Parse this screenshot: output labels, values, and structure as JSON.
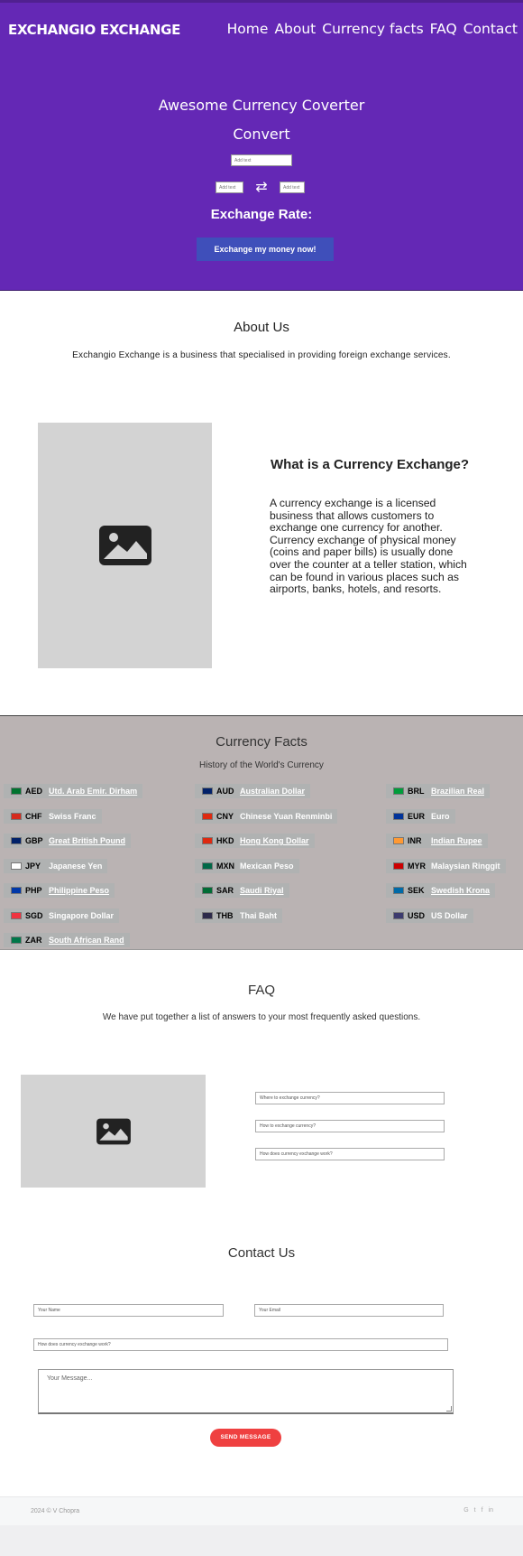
{
  "header": {
    "brand": "EXCHANGIO EXCHANGE",
    "nav": [
      "Home",
      "About",
      "Currency facts",
      "FAQ",
      "Contact"
    ]
  },
  "hero": {
    "title": "Awesome Currency Coverter",
    "convert_label": "Convert",
    "amount_placeholder": "Add text",
    "from_placeholder": "Add text",
    "to_placeholder": "Add text",
    "rate_label": "Exchange Rate:",
    "button": "Exchange my money now!"
  },
  "about": {
    "title": "About Us",
    "text": "Exchangio Exchange is a business that specialised in providing foreign exchange services.",
    "subtitle": "What is a Currency Exchange?",
    "body": "A currency exchange is a licensed business that allows customers to exchange one currency for another. Currency exchange of physical money (coins and paper bills) is usually done over the counter at a teller station, which can be found in various places such as airports, banks, hotels, and resorts."
  },
  "facts": {
    "title": "Currency Facts",
    "subtitle": "History of the World's Currency",
    "currencies": [
      {
        "code": "AED",
        "name": "Utd. Arab Emir. Dirham",
        "link": true,
        "flag": "#00732f"
      },
      {
        "code": "AUD",
        "name": "Australian Dollar",
        "link": true,
        "flag": "#012169"
      },
      {
        "code": "BRL",
        "name": "Brazilian Real",
        "link": true,
        "flag": "#009c3b"
      },
      {
        "code": "CHF",
        "name": "Swiss Franc",
        "link": false,
        "flag": "#d52b1e"
      },
      {
        "code": "CNY",
        "name": "Chinese Yuan Renminbi",
        "link": false,
        "flag": "#de2910"
      },
      {
        "code": "EUR",
        "name": "Euro",
        "link": false,
        "flag": "#003399"
      },
      {
        "code": "GBP",
        "name": "Great British Pound",
        "link": true,
        "flag": "#012169"
      },
      {
        "code": "HKD",
        "name": "Hong Kong Dollar",
        "link": true,
        "flag": "#de2910"
      },
      {
        "code": "INR",
        "name": "Indian Rupee",
        "link": true,
        "flag": "#ff9933"
      },
      {
        "code": "JPY",
        "name": "Japanese Yen",
        "link": false,
        "flag": "#ffffff"
      },
      {
        "code": "MXN",
        "name": "Mexican Peso",
        "link": false,
        "flag": "#006847"
      },
      {
        "code": "MYR",
        "name": "Malaysian Ringgit",
        "link": false,
        "flag": "#cc0001"
      },
      {
        "code": "PHP",
        "name": "Philippine Peso",
        "link": true,
        "flag": "#0038a8"
      },
      {
        "code": "SAR",
        "name": "Saudi Riyal",
        "link": true,
        "flag": "#006c35"
      },
      {
        "code": "SEK",
        "name": "Swedish Krona",
        "link": true,
        "flag": "#006aa7"
      },
      {
        "code": "SGD",
        "name": "Singapore Dollar",
        "link": false,
        "flag": "#ef3340"
      },
      {
        "code": "THB",
        "name": "Thai Baht",
        "link": false,
        "flag": "#2d2a4a"
      },
      {
        "code": "USD",
        "name": "US Dollar",
        "link": false,
        "flag": "#3c3b6e"
      },
      {
        "code": "ZAR",
        "name": "South African Rand",
        "link": true,
        "flag": "#007749"
      }
    ]
  },
  "faq": {
    "title": "FAQ",
    "text": "We have put together a list of answers to your most frequently asked questions.",
    "questions": [
      "Where to exchange currency?",
      "How to exchange currency?",
      "How does currency exchange work?"
    ]
  },
  "contact": {
    "title": "Contact Us",
    "name_placeholder": "Your Name",
    "email_placeholder": "Your Email",
    "subject_value": "How does currency exchange work?",
    "message_placeholder": "Your Message...",
    "button": "SEND MESSAGE"
  },
  "footer": {
    "copyright": "2024 © V Chopra",
    "social": [
      "G",
      "t",
      "f",
      "in"
    ]
  }
}
